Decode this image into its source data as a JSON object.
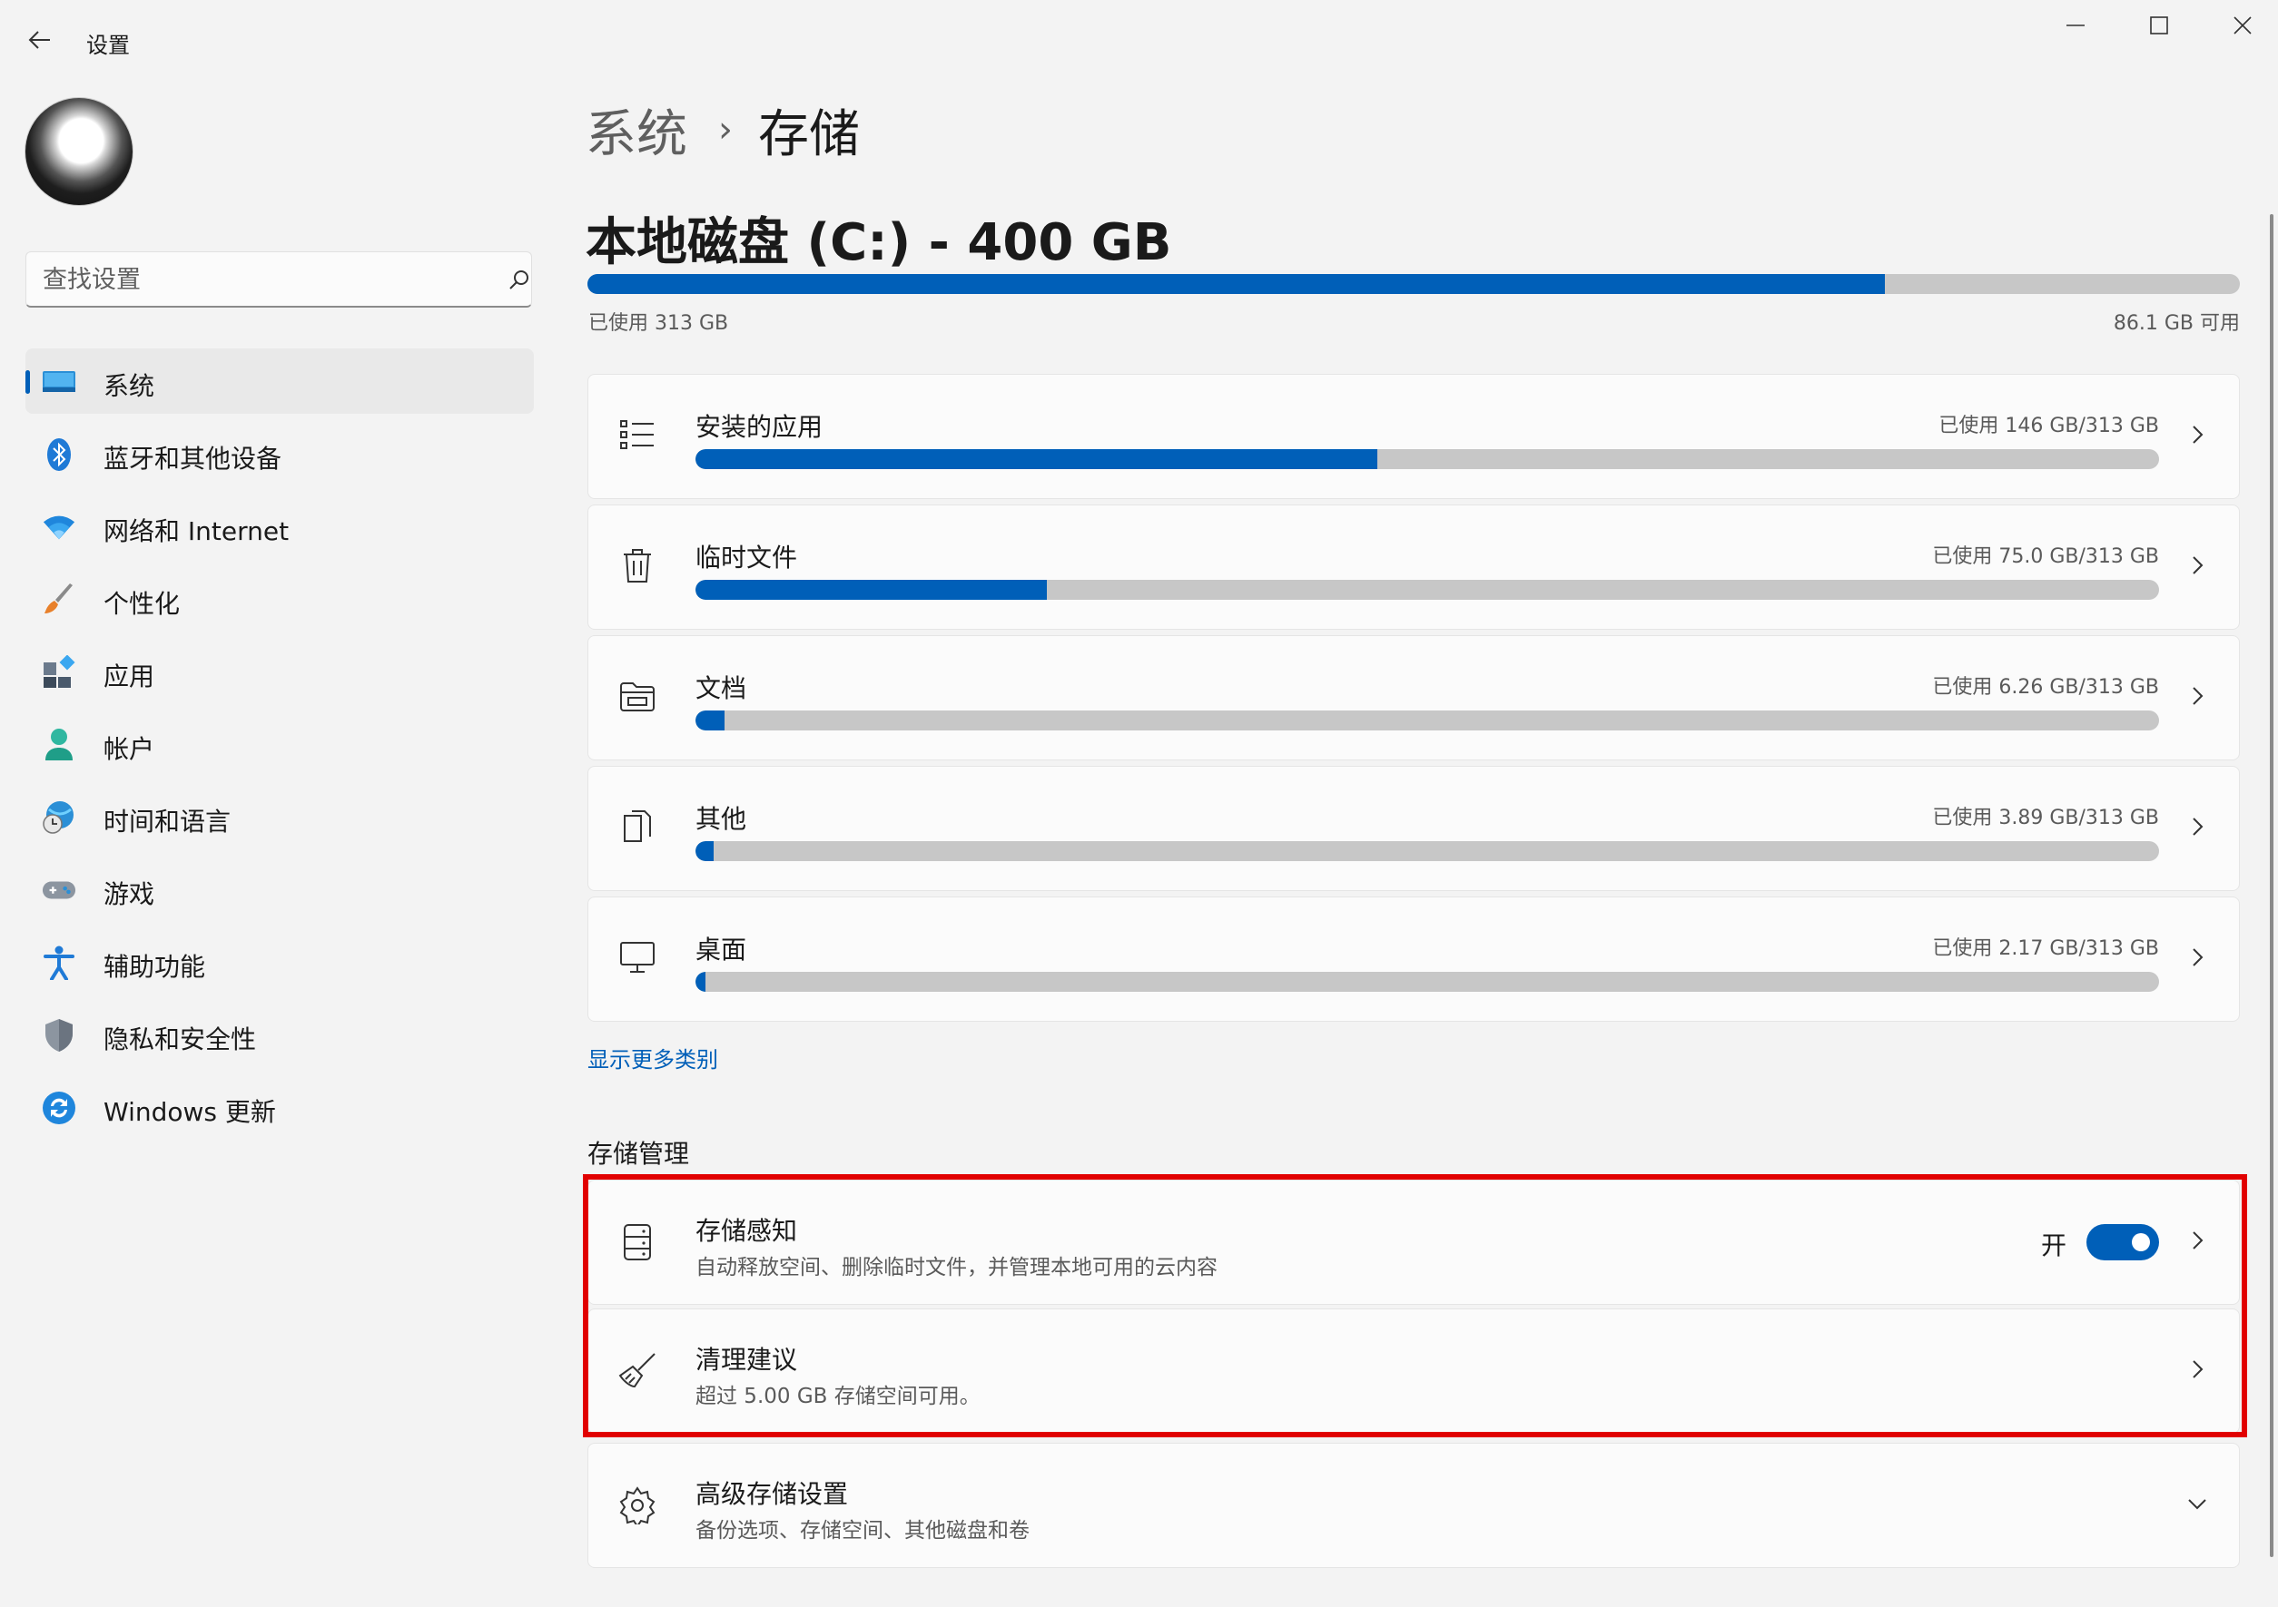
{
  "window": {
    "title": "设置",
    "back_icon": "arrow-left-icon",
    "controls": [
      "minimize-icon",
      "maximize-icon",
      "close-icon"
    ]
  },
  "sidebar": {
    "search": {
      "placeholder": "查找设置",
      "value": ""
    },
    "items": [
      {
        "label": "系统",
        "icon": "system-display-icon",
        "active": true
      },
      {
        "label": "蓝牙和其他设备",
        "icon": "bluetooth-icon",
        "active": false
      },
      {
        "label": "网络和 Internet",
        "icon": "wifi-icon",
        "active": false
      },
      {
        "label": "个性化",
        "icon": "paintbrush-icon",
        "active": false
      },
      {
        "label": "应用",
        "icon": "apps-icon",
        "active": false
      },
      {
        "label": "帐户",
        "icon": "account-icon",
        "active": false
      },
      {
        "label": "时间和语言",
        "icon": "globe-clock-icon",
        "active": false
      },
      {
        "label": "游戏",
        "icon": "gamepad-icon",
        "active": false
      },
      {
        "label": "辅助功能",
        "icon": "accessibility-icon",
        "active": false
      },
      {
        "label": "隐私和安全性",
        "icon": "shield-icon",
        "active": false
      },
      {
        "label": "Windows 更新",
        "icon": "update-icon",
        "active": false
      }
    ]
  },
  "main": {
    "breadcrumb": {
      "parent": "系统",
      "separator": "›",
      "current": "存储"
    },
    "disk": {
      "title": "本地磁盘 (C:) - 400 GB",
      "used_label": "已使用 313 GB",
      "free_label": "86.1 GB 可用",
      "used_fraction": 0.785
    },
    "categories": [
      {
        "label": "安装的应用",
        "usage": "已使用 146 GB/313 GB",
        "fraction": 0.466,
        "icon": "list-icon"
      },
      {
        "label": "临时文件",
        "usage": "已使用 75.0 GB/313 GB",
        "fraction": 0.24,
        "icon": "trash-icon"
      },
      {
        "label": "文档",
        "usage": "已使用 6.26 GB/313 GB",
        "fraction": 0.02,
        "icon": "folder-icon"
      },
      {
        "label": "其他",
        "usage": "已使用 3.89 GB/313 GB",
        "fraction": 0.0124,
        "icon": "file-copy-icon"
      },
      {
        "label": "桌面",
        "usage": "已使用 2.17 GB/313 GB",
        "fraction": 0.0069,
        "icon": "monitor-icon"
      }
    ],
    "show_more": "显示更多类别",
    "management": {
      "title": "存储管理",
      "items": [
        {
          "title": "存储感知",
          "desc": "自动释放空间、删除临时文件，并管理本地可用的云内容",
          "toggle_label": "开",
          "toggle_on": true,
          "icon": "storage-drive-icon"
        },
        {
          "title": "清理建议",
          "desc": "超过 5.00 GB 存储空间可用。",
          "icon": "broom-icon"
        },
        {
          "title": "高级存储设置",
          "desc": "备份选项、存储空间、其他磁盘和卷",
          "icon": "gear-icon"
        }
      ]
    }
  },
  "colors": {
    "accent": "#005fb8",
    "highlight": "#e10000",
    "track": "#c7c7c7"
  }
}
